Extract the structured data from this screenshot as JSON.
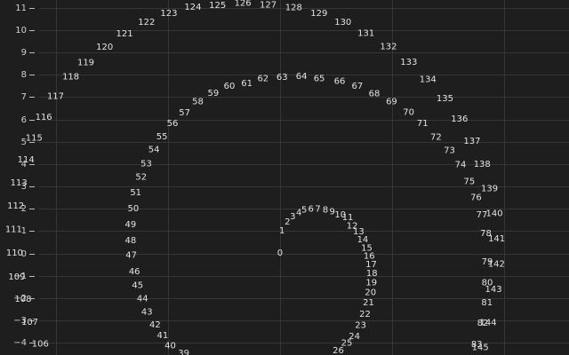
{
  "chart_data": {
    "type": "scatter",
    "marker": "text-label",
    "grid": true,
    "yticks": [
      11,
      10,
      9,
      8,
      7,
      6,
      5,
      4,
      3,
      2,
      1,
      0,
      -1,
      -2,
      -3,
      -4
    ],
    "ytick_labels": [
      "11",
      "10",
      "9",
      "8",
      "7",
      "6",
      "5",
      "4",
      "3",
      "2",
      "1",
      "0",
      "−1",
      "−2",
      "−3",
      "−4"
    ],
    "ylim": [
      -4.55,
      11.35
    ],
    "xlim": [
      -12.5,
      12.9
    ],
    "points": [
      {
        "label": "0",
        "x": 0.0,
        "y": 0.0
      },
      {
        "label": "1",
        "x": 0.09,
        "y": 0.99
      },
      {
        "label": "2",
        "x": 0.33,
        "y": 1.39
      },
      {
        "label": "3",
        "x": 0.57,
        "y": 1.64
      },
      {
        "label": "4",
        "x": 0.84,
        "y": 1.81
      },
      {
        "label": "5",
        "x": 1.08,
        "y": 1.92
      },
      {
        "label": "6",
        "x": 1.38,
        "y": 1.96
      },
      {
        "label": "7",
        "x": 1.69,
        "y": 1.96
      },
      {
        "label": "8",
        "x": 2.03,
        "y": 1.92
      },
      {
        "label": "9",
        "x": 2.33,
        "y": 1.85
      },
      {
        "label": "10",
        "x": 2.69,
        "y": 1.71
      },
      {
        "label": "11",
        "x": 3.02,
        "y": 1.59
      },
      {
        "label": "12",
        "x": 3.22,
        "y": 1.21
      },
      {
        "label": "13",
        "x": 3.51,
        "y": 0.96
      },
      {
        "label": "14",
        "x": 3.69,
        "y": 0.59
      },
      {
        "label": "15",
        "x": 3.87,
        "y": 0.22
      },
      {
        "label": "16",
        "x": 3.98,
        "y": -0.14
      },
      {
        "label": "17",
        "x": 4.07,
        "y": -0.52
      },
      {
        "label": "18",
        "x": 4.1,
        "y": -0.91
      },
      {
        "label": "19",
        "x": 4.08,
        "y": -1.33
      },
      {
        "label": "20",
        "x": 4.04,
        "y": -1.77
      },
      {
        "label": "21",
        "x": 3.95,
        "y": -2.23
      },
      {
        "label": "22",
        "x": 3.79,
        "y": -2.74
      },
      {
        "label": "23",
        "x": 3.6,
        "y": -3.24
      },
      {
        "label": "24",
        "x": 3.32,
        "y": -3.73
      },
      {
        "label": "25",
        "x": 2.98,
        "y": -4.04
      },
      {
        "label": "26",
        "x": 2.6,
        "y": -4.38
      },
      {
        "label": "39",
        "x": -4.3,
        "y": -4.49
      },
      {
        "label": "40",
        "x": -4.9,
        "y": -4.15
      },
      {
        "label": "41",
        "x": -5.24,
        "y": -3.7
      },
      {
        "label": "42",
        "x": -5.58,
        "y": -3.21
      },
      {
        "label": "43",
        "x": -5.94,
        "y": -2.65
      },
      {
        "label": "44",
        "x": -6.14,
        "y": -2.04
      },
      {
        "label": "45",
        "x": -6.36,
        "y": -1.44
      },
      {
        "label": "46",
        "x": -6.5,
        "y": -0.83
      },
      {
        "label": "47",
        "x": -6.64,
        "y": -0.1
      },
      {
        "label": "48",
        "x": -6.67,
        "y": 0.56
      },
      {
        "label": "49",
        "x": -6.67,
        "y": 1.28
      },
      {
        "label": "50",
        "x": -6.55,
        "y": 1.99
      },
      {
        "label": "51",
        "x": -6.44,
        "y": 2.7
      },
      {
        "label": "52",
        "x": -6.2,
        "y": 3.4
      },
      {
        "label": "53",
        "x": -5.97,
        "y": 3.99
      },
      {
        "label": "54",
        "x": -5.63,
        "y": 4.63
      },
      {
        "label": "55",
        "x": -5.27,
        "y": 5.21
      },
      {
        "label": "56",
        "x": -4.8,
        "y": 5.81
      },
      {
        "label": "57",
        "x": -4.26,
        "y": 6.28
      },
      {
        "label": "58",
        "x": -3.67,
        "y": 6.77
      },
      {
        "label": "59",
        "x": -2.98,
        "y": 7.16
      },
      {
        "label": "60",
        "x": -2.26,
        "y": 7.47
      },
      {
        "label": "61",
        "x": -1.48,
        "y": 7.6
      },
      {
        "label": "62",
        "x": -0.76,
        "y": 7.81
      },
      {
        "label": "63",
        "x": 0.09,
        "y": 7.88
      },
      {
        "label": "64",
        "x": 0.96,
        "y": 7.91
      },
      {
        "label": "65",
        "x": 1.75,
        "y": 7.82
      },
      {
        "label": "66",
        "x": 2.66,
        "y": 7.69
      },
      {
        "label": "67",
        "x": 3.45,
        "y": 7.47
      },
      {
        "label": "68",
        "x": 4.21,
        "y": 7.14
      },
      {
        "label": "69",
        "x": 4.98,
        "y": 6.77
      },
      {
        "label": "70",
        "x": 5.74,
        "y": 6.3
      },
      {
        "label": "71",
        "x": 6.36,
        "y": 5.81
      },
      {
        "label": "72",
        "x": 6.96,
        "y": 5.19
      },
      {
        "label": "73",
        "x": 7.56,
        "y": 4.59
      },
      {
        "label": "74",
        "x": 8.06,
        "y": 3.95
      },
      {
        "label": "75",
        "x": 8.45,
        "y": 3.2
      },
      {
        "label": "76",
        "x": 8.75,
        "y": 2.49
      },
      {
        "label": "77",
        "x": 9.01,
        "y": 1.71
      },
      {
        "label": "78",
        "x": 9.19,
        "y": 0.88
      },
      {
        "label": "79",
        "x": 9.25,
        "y": -0.39
      },
      {
        "label": "80",
        "x": 9.25,
        "y": -1.33
      },
      {
        "label": "81",
        "x": 9.24,
        "y": -2.23
      },
      {
        "label": "82",
        "x": 9.05,
        "y": -3.14
      },
      {
        "label": "83",
        "x": 8.78,
        "y": -4.1
      },
      {
        "label": "106",
        "x": -10.7,
        "y": -4.07
      },
      {
        "label": "107",
        "x": -11.17,
        "y": -3.1
      },
      {
        "label": "108",
        "x": -11.47,
        "y": -2.07
      },
      {
        "label": "109",
        "x": -11.75,
        "y": -1.08
      },
      {
        "label": "110",
        "x": -11.85,
        "y": 0.01
      },
      {
        "label": "111",
        "x": -11.89,
        "y": 1.06
      },
      {
        "label": "112",
        "x": -11.8,
        "y": 2.1
      },
      {
        "label": "113",
        "x": -11.66,
        "y": 3.15
      },
      {
        "label": "114",
        "x": -11.34,
        "y": 4.18
      },
      {
        "label": "115",
        "x": -10.98,
        "y": 5.15
      },
      {
        "label": "116",
        "x": -10.55,
        "y": 6.08
      },
      {
        "label": "117",
        "x": -10.02,
        "y": 7.01
      },
      {
        "label": "118",
        "x": -9.34,
        "y": 7.89
      },
      {
        "label": "119",
        "x": -8.67,
        "y": 8.53
      },
      {
        "label": "120",
        "x": -7.83,
        "y": 9.23
      },
      {
        "label": "121",
        "x": -6.94,
        "y": 9.82
      },
      {
        "label": "122",
        "x": -5.96,
        "y": 10.33
      },
      {
        "label": "123",
        "x": -4.96,
        "y": 10.74
      },
      {
        "label": "124",
        "x": -3.89,
        "y": 11.01
      },
      {
        "label": "125",
        "x": -2.79,
        "y": 11.1
      },
      {
        "label": "126",
        "x": -1.66,
        "y": 11.19
      },
      {
        "label": "127",
        "x": -0.53,
        "y": 11.12
      },
      {
        "label": "128",
        "x": 0.61,
        "y": 11.0
      },
      {
        "label": "129",
        "x": 1.74,
        "y": 10.73
      },
      {
        "label": "130",
        "x": 2.81,
        "y": 10.34
      },
      {
        "label": "131",
        "x": 3.84,
        "y": 9.83
      },
      {
        "label": "132",
        "x": 4.84,
        "y": 9.24
      },
      {
        "label": "133",
        "x": 5.75,
        "y": 8.55
      },
      {
        "label": "134",
        "x": 6.6,
        "y": 7.78
      },
      {
        "label": "135",
        "x": 7.36,
        "y": 6.92
      },
      {
        "label": "136",
        "x": 8.01,
        "y": 6.0
      },
      {
        "label": "137",
        "x": 8.57,
        "y": 5.01
      },
      {
        "label": "138",
        "x": 9.02,
        "y": 3.97
      },
      {
        "label": "139",
        "x": 9.35,
        "y": 2.88
      },
      {
        "label": "140",
        "x": 9.57,
        "y": 1.77
      },
      {
        "label": "141",
        "x": 9.67,
        "y": 0.63
      },
      {
        "label": "142",
        "x": 9.66,
        "y": -0.49
      },
      {
        "label": "143",
        "x": 9.53,
        "y": -1.63
      },
      {
        "label": "144",
        "x": 9.29,
        "y": -3.12
      },
      {
        "label": "145",
        "x": 8.94,
        "y": -4.23
      }
    ]
  }
}
